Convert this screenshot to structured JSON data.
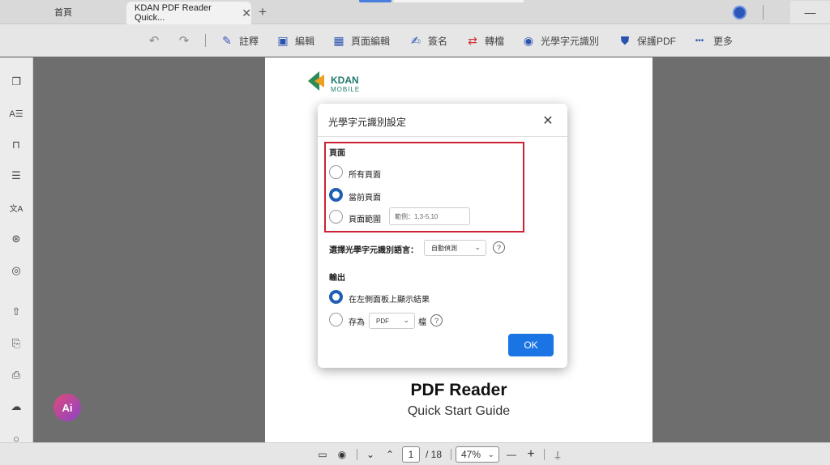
{
  "tabs": {
    "home_label": "首頁",
    "active_label": "KDAN PDF Reader Quick...",
    "close_symbol": "✕",
    "add_symbol": "+"
  },
  "window": {
    "minimize_symbol": "—"
  },
  "toolbar": {
    "undo_symbol": "↶",
    "redo_symbol": "↷",
    "items": [
      {
        "label": "註釋",
        "icon": "pen-icon",
        "glyph": "✎"
      },
      {
        "label": "編輯",
        "icon": "edit-frame-icon",
        "glyph": "▣"
      },
      {
        "label": "頁面編輯",
        "icon": "page-grid-icon",
        "glyph": "▦"
      },
      {
        "label": "簽名",
        "icon": "signature-icon",
        "glyph": "✍"
      },
      {
        "label": "轉檔",
        "icon": "convert-icon",
        "glyph": "⇄"
      },
      {
        "label": "光學字元識別",
        "icon": "ocr-icon",
        "glyph": "◉"
      },
      {
        "label": "保護PDF",
        "icon": "shield-icon",
        "glyph": "⛊"
      },
      {
        "label": "更多",
        "icon": "more-dots-icon",
        "glyph": "•••"
      }
    ]
  },
  "sidebar": {
    "icons": [
      {
        "name": "thumbnails-icon",
        "glyph": "❐"
      },
      {
        "name": "text-outline-icon",
        "glyph": "A☰"
      },
      {
        "name": "bookmark-icon",
        "glyph": "⊓"
      },
      {
        "name": "list-icon",
        "glyph": "☰"
      },
      {
        "name": "translate-icon",
        "glyph": "文A"
      },
      {
        "name": "ocr-sidebar-icon",
        "glyph": "⊛"
      },
      {
        "name": "view-eye-icon",
        "glyph": "◎"
      },
      {
        "name": "share-icon",
        "glyph": "⇧"
      },
      {
        "name": "save-as-icon",
        "glyph": "⎘"
      },
      {
        "name": "print-icon",
        "glyph": "⎙"
      },
      {
        "name": "cloud-upload-icon",
        "glyph": "☁"
      },
      {
        "name": "search-icon",
        "glyph": "○"
      }
    ]
  },
  "document": {
    "logo_text": "KDAN",
    "logo_sub": "MOBILE",
    "title": "PDF Reader",
    "subtitle": "Quick Start Guide"
  },
  "ai_button": {
    "label": "Ai"
  },
  "dialog": {
    "title": "光學字元識別設定",
    "close_symbol": "✕",
    "pages_section": "頁面",
    "page_options": [
      {
        "label": "所有頁面",
        "checked": false
      },
      {
        "label": "當前頁面",
        "checked": true
      },
      {
        "label": "頁面範圍",
        "checked": false
      }
    ],
    "range_placeholder": "範例：1,3-5,10",
    "language_label": "選擇光學字元識別語言：",
    "language_value": "自動偵測",
    "output_section": "輸出",
    "output_options": [
      {
        "label": "在左側面板上顯示結果",
        "checked": true
      },
      {
        "label": "存為",
        "checked": false
      }
    ],
    "format_value": "PDF",
    "format_suffix": "檔",
    "help_symbol": "?",
    "ok_label": "OK"
  },
  "bottombar": {
    "current_page": "1",
    "page_total": "/ 18",
    "zoom": "47%",
    "minus": "—",
    "plus": "+"
  },
  "colors": {
    "accent": "#1b74e4",
    "radio_checked": "#1f5fb3",
    "highlight_border": "#cc2233"
  }
}
